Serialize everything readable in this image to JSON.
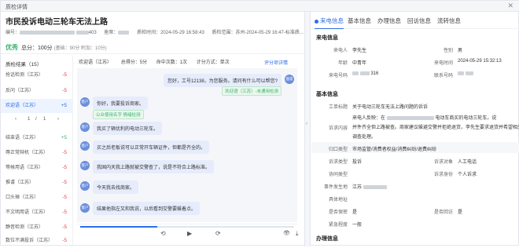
{
  "window": {
    "title": "质检详情",
    "close": "✕"
  },
  "header": {
    "title": "市民投诉电动三轮车无法上路",
    "meta_id_label": "编号：",
    "meta_id_tail": "403",
    "meta_seat_label": "座席：",
    "meta_time_label": "质检时间：",
    "meta_time": "2024-05-29 16:58:43",
    "meta_region_label": "质检范围：",
    "meta_region": "苏州-2024-05-29 16:47-标准质..."
  },
  "score": {
    "grade": "优秀",
    "total": "总分：100分",
    "detail": "(基础：90分 附加：10分)"
  },
  "rules": {
    "header": "质检结果（15）",
    "items": [
      {
        "name": "抢话检测（江苏）",
        "score": "-5"
      },
      {
        "name": "反问（江苏）",
        "score": "-5"
      },
      {
        "name": "欢迎语（江苏）",
        "score": "+5"
      },
      {
        "name": "结束语（江苏）",
        "score": "+5"
      },
      {
        "name": "辱正常辩机（江苏）",
        "score": "-5"
      },
      {
        "name": "等候用语（江苏）",
        "score": "-5"
      },
      {
        "name": "推诿（江苏）",
        "score": "-5"
      },
      {
        "name": "口头禅（江苏）",
        "score": "-5"
      },
      {
        "name": "不文明用语（江苏）",
        "score": "-5"
      },
      {
        "name": "静音检测（江苏）",
        "score": "-5"
      },
      {
        "name": "数位不满投诉（江苏）",
        "score": "-5"
      }
    ],
    "pager": {
      "prev": "‹",
      "current": "1",
      "sep": "/",
      "total": "1",
      "next": "›"
    }
  },
  "stats": {
    "rule": "欢迎语（江苏）",
    "total": "总得分：5分",
    "hits": "命中次数：1次",
    "method": "计分方式：单次",
    "detail_link": "评分项详情"
  },
  "chat": {
    "messages": [
      {
        "side": "right",
        "avatar": "座席",
        "text": "您好，工号12138，为您服务。请问有什么可以帮您?"
      },
      {
        "side": "left",
        "avatar": "客户",
        "text": "你好，我要投诉商家。"
      },
      {
        "side": "left",
        "avatar": "客户",
        "text": "我买了辆优利的电动三轮车。"
      },
      {
        "side": "left",
        "avatar": "客户",
        "text": "买之后老板说可以正常开车辆证件，但都是齐全的。"
      },
      {
        "side": "left",
        "avatar": "客户",
        "text": "我国内天我上路就被交警查了，说是不符合上路标准。"
      },
      {
        "side": "left",
        "avatar": "客户",
        "text": "今天我去找商家。"
      },
      {
        "side": "left",
        "avatar": "客户",
        "text": "结果他指左又和我说，以后看到交警要躲着点。"
      }
    ],
    "tag_right": "欢迎语（江苏）-未通用检测",
    "tag_left": "公众使用名字 情绪检测"
  },
  "controls": {
    "back": "⟲",
    "play": "▶",
    "forward": "⟳",
    "view": "👁",
    "download": "⤓"
  },
  "tabs": [
    "来电信息",
    "基本信息",
    "办理信息",
    "回访信息",
    "流转信息"
  ],
  "caller": {
    "section": "来电信息",
    "name_label": "来电人",
    "name": "李先生",
    "gender_label": "性别",
    "gender": "男",
    "age_label": "年龄",
    "age": "中青年",
    "call_time_label": "来电时间",
    "call_time": "2024-05-29 15:32:13",
    "phone_label": "来电号码",
    "phone_tail": "316",
    "contact_label": "联系号码"
  },
  "basic": {
    "section": "基本信息",
    "title_label": "工单标题",
    "title": "关于电动三轮车无法上路问题的诉诉",
    "content_label": "诉求内容",
    "content_1": "来电人反映：在",
    "content_1b": "电动车商买的电动三轮车。说",
    "content_2": "并件齐全但上路被查。商家建议躲避交警并拒绝退货，李先生要求退货并希望相关部门",
    "content_3": "调查处理。",
    "category_label": "归口类型",
    "category": "市场监管/消费者权益/消费纠纷/退费纠纷",
    "type_label": "诉求类型",
    "type": "投诉",
    "object_label": "诉求对象",
    "object": "人工电话",
    "assist_label": "协同类型",
    "assist": "",
    "identity_label": "诉求身份",
    "identity": "个人诉求",
    "location_label": "事件发生地",
    "location": "江苏",
    "address_label": "具体地址",
    "address": "",
    "secret_label": "是否保密",
    "secret": "是",
    "revisit_label": "是否回访",
    "revisit": "是",
    "urgency_label": "紧急程度",
    "urgency": "一般"
  },
  "handle": {
    "section": "办理信息"
  }
}
